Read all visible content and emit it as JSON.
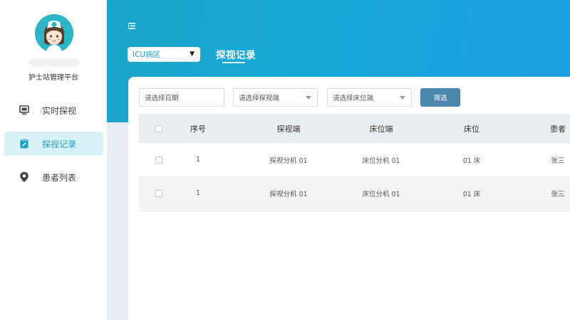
{
  "sidebar": {
    "platform_name": "护士站管理平台",
    "items": [
      {
        "label": "实时探视",
        "icon": "monitor-icon",
        "active": false
      },
      {
        "label": "探视记录",
        "icon": "clipboard-icon",
        "active": true
      },
      {
        "label": "患者列表",
        "icon": "location-pin-icon",
        "active": false
      }
    ]
  },
  "header": {
    "ward_select": "ICU病区",
    "page_title": "探视记录"
  },
  "filters": {
    "date_placeholder": "请选择日期",
    "visit_terminal_placeholder": "请选择探视端",
    "bed_terminal_placeholder": "请选择床位端",
    "filter_button": "筛选"
  },
  "table": {
    "columns": [
      "序号",
      "探视端",
      "床位端",
      "床位",
      "患者"
    ],
    "rows": [
      {
        "index": "1",
        "visit_terminal": "探视分机 01",
        "bed_terminal": "床位分机 01",
        "bed": "01 床",
        "patient": "张三"
      },
      {
        "index": "1",
        "visit_terminal": "探视分机 01",
        "bed_terminal": "床位分机 01",
        "bed": "01 床",
        "patient": "张三"
      }
    ]
  },
  "colors": {
    "accent": "#1aa3bd",
    "header_gradient_start": "#1aa6c9",
    "header_gradient_end": "#1f9fe0",
    "filter_button": "#4a86ad",
    "active_nav_bg": "#d8f1f5"
  }
}
